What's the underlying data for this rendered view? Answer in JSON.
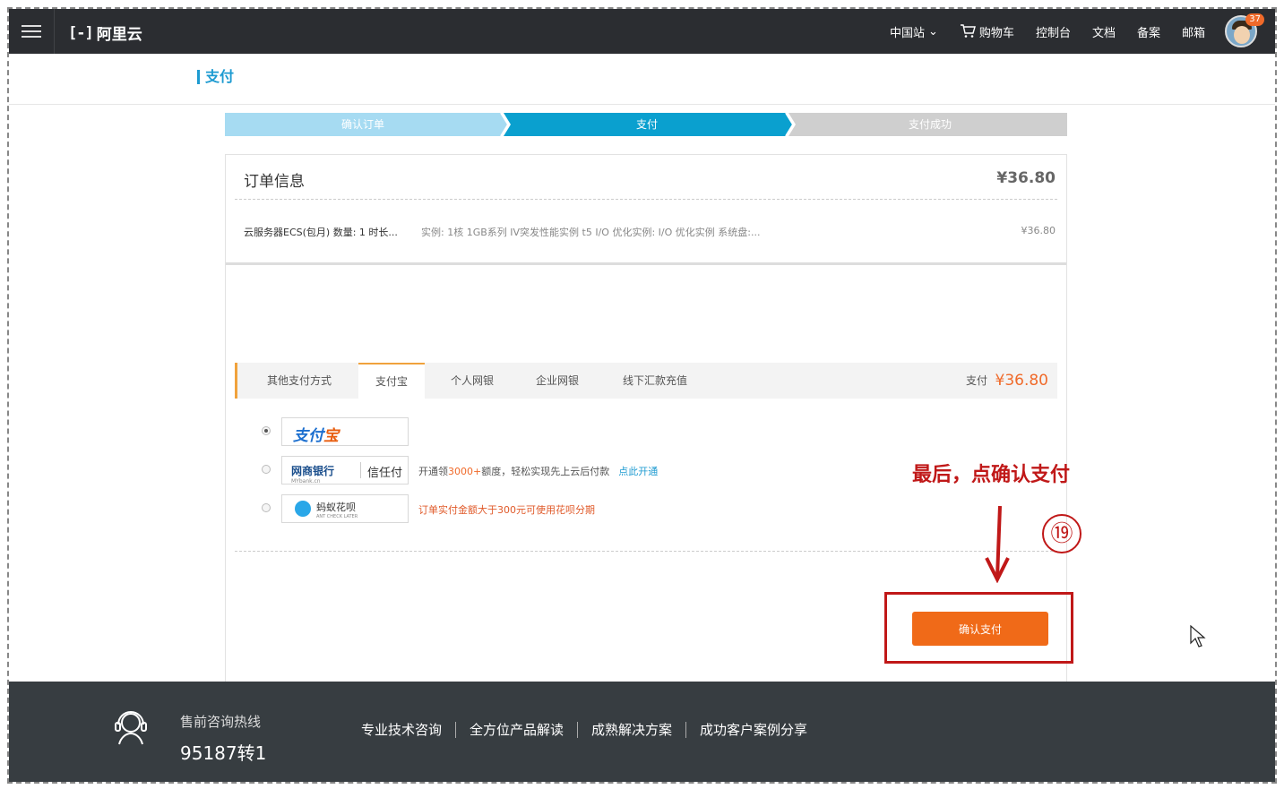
{
  "header": {
    "brand": "阿里云",
    "nav": [
      "中国站",
      "购物车",
      "控制台",
      "文档",
      "备案",
      "邮箱"
    ],
    "badge": "37"
  },
  "page_title": "支付",
  "steps": [
    "确认订单",
    "支付",
    "支付成功"
  ],
  "order": {
    "heading": "订单信息",
    "total": "¥36.80",
    "item": "云服务器ECS(包月) 数量: 1 时长...",
    "spec": "实例: 1核 1GB系列 IV突发性能实例 t5 I/O 优化实例: I/O 优化实例 系统盘:...",
    "price": "¥36.80"
  },
  "tabs": [
    "其他支付方式",
    "支付宝",
    "个人网银",
    "企业网银",
    "线下汇款充值"
  ],
  "pay": {
    "label": "支付",
    "amount": "¥36.80"
  },
  "options": {
    "alipay": {
      "logo_a": "支付",
      "logo_b": "宝"
    },
    "mybank": {
      "logo": "网商银行",
      "logo_sub": "MYbank.cn",
      "logo2": "信任付",
      "note_a": "开通领",
      "note_amount": "3000+",
      "note_b": "额度，轻松实现先上云后付款",
      "link": "点此开通"
    },
    "huabei": {
      "logo": "蚂蚁花呗",
      "logo_sub": "ANT CHECK LATER",
      "note": "订单实付金额大于300元可使用花呗分期"
    }
  },
  "confirm_button": "确认支付",
  "annotation": {
    "text": "最后，点确认支付",
    "step": "⑲"
  },
  "footer": {
    "hotline_label": "售前咨询热线",
    "hotline_number": "95187转1",
    "links": [
      "专业技术咨询",
      "全方位产品解读",
      "成熟解决方案",
      "成功客户案例分享"
    ]
  },
  "colors": {
    "step_done": "#a6dbf2",
    "step_active": "#0aa0cf",
    "step_todo": "#cfcfcf",
    "accent": "#f06a18",
    "annotation": "#c01818"
  }
}
